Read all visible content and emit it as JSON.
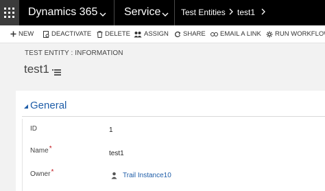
{
  "nav": {
    "app_name": "Dynamics 365",
    "area": "Service",
    "breadcrumbs": [
      "Test Entities",
      "test1"
    ]
  },
  "commands": [
    {
      "label": "NEW",
      "icon": "plus-icon"
    },
    {
      "label": "DEACTIVATE",
      "icon": "deactivate-icon"
    },
    {
      "label": "DELETE",
      "icon": "trash-icon"
    },
    {
      "label": "ASSIGN",
      "icon": "assign-icon"
    },
    {
      "label": "SHARE",
      "icon": "share-icon"
    },
    {
      "label": "EMAIL A LINK",
      "icon": "email-link-icon"
    },
    {
      "label": "RUN WORKFLOW",
      "icon": "run-workflow-icon"
    }
  ],
  "header": {
    "entity_label": "TEST ENTITY : INFORMATION",
    "record_name": "test1"
  },
  "section": {
    "title": "General",
    "fields": [
      {
        "label": "ID",
        "value": "1",
        "required": false
      },
      {
        "label": "Name",
        "value": "test1",
        "required": true
      },
      {
        "label": "Owner",
        "value": "Trail Instance10",
        "required": true
      }
    ]
  },
  "colors": {
    "nav_bg": "#000000",
    "link_blue": "#1e5da8",
    "required_red": "#c0141b"
  }
}
